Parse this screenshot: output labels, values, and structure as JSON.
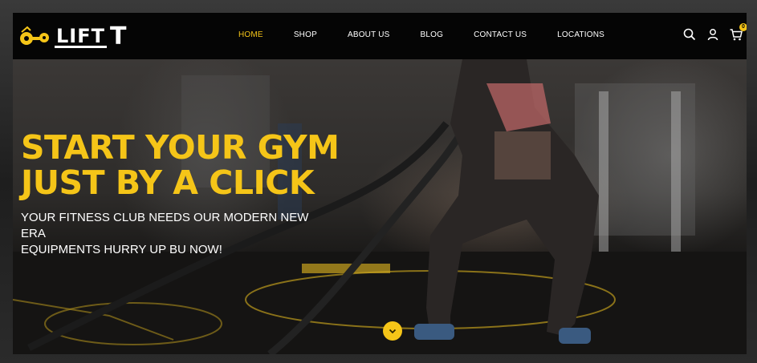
{
  "brand": {
    "logo_text": "LIFT",
    "logo_suffix": "T"
  },
  "nav": {
    "items": [
      {
        "label": "HOME",
        "active": true
      },
      {
        "label": "SHOP"
      },
      {
        "label": "ABOUT US"
      },
      {
        "label": "BLOG"
      },
      {
        "label": "CONTACT US"
      },
      {
        "label": "LOCATIONS"
      }
    ]
  },
  "header_icons": {
    "search": "search-icon",
    "account": "user-icon",
    "cart": "cart-icon",
    "cart_count": "0"
  },
  "hero": {
    "headline_line1": "START YOUR GYM",
    "headline_line2": "JUST BY A CLICK",
    "subline_line1": "YOUR FITNESS CLUB NEEDS OUR MODERN NEW ERA",
    "subline_line2": "EQUIPMENTS HURRY UP BU NOW!",
    "scroll_icon": "chevron-down-icon"
  },
  "colors": {
    "accent": "#f5c518",
    "header_bg": "#050505",
    "text": "#ffffff"
  }
}
